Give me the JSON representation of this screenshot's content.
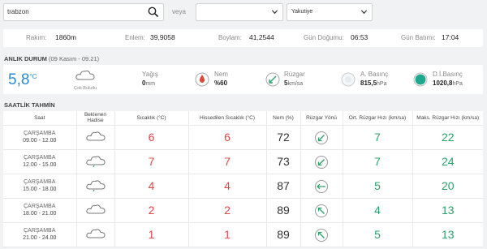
{
  "search": {
    "value": "trabzon",
    "placeholder": ""
  },
  "veya": "veya",
  "select1": {
    "value": ""
  },
  "select2": {
    "value": "Yakutiye"
  },
  "info": {
    "rakim_label": "Rakım:",
    "rakim_value": "1860",
    "rakim_unit": "m",
    "enlem_label": "Enlem:",
    "enlem_value": "39,9058",
    "boylam_label": "Boylam:",
    "boylam_value": "41,2544",
    "dogumu_label": "Gün Doğumu:",
    "dogumu_value": "06:53",
    "batimi_label": "Gün Batımı:",
    "batimi_value": "17:04"
  },
  "current_title": "ANLIK DURUM",
  "current_sub": "(09 Kasım - 09.21)",
  "current": {
    "temp": "5,8",
    "temp_unit": "°C",
    "condition": "Çok Bulutlu",
    "yagis_label": "Yağış",
    "yagis_value": "0",
    "yagis_unit": "mm",
    "nem_label": "Nem",
    "nem_value": "%60",
    "ruzgar_label": "Rüzgar",
    "ruzgar_value": "5",
    "ruzgar_unit": "km/sa",
    "basinc_label": "A. Basınç",
    "basinc_value": "815,5",
    "basinc_unit": "hPa",
    "dibasinc_label": "D.İ.Basınç",
    "dibasinc_value": "1020,8",
    "dibasinc_unit": "hPa"
  },
  "hourly_title": "SAATLİK TAHMİN",
  "table": {
    "headers": {
      "saat": "Saat",
      "hadise_1": "Beklenen",
      "hadise_2": "Hadise",
      "sicaklik": "Sıcaklık (°C)",
      "hissedilen": "Hissedilen Sıcaklık (°C)",
      "nem": "Nem (%)",
      "yon": "Rüzgar Yönü",
      "ort": "Ort. Rüzgar Hızı (km/sa)",
      "maks": "Maks. Rüzgar Hızı (km/sa)"
    },
    "rows": [
      {
        "day": "ÇARŞAMBA",
        "time": "09.00 - 12.00",
        "icon": "cloud-icon",
        "temp": "6",
        "feels": "6",
        "hum": "72",
        "dir_deg": 225,
        "avg": "7",
        "max": "22"
      },
      {
        "day": "ÇARŞAMBA",
        "time": "12.00 - 15.00",
        "icon": "cloud-rain-icon",
        "temp": "7",
        "feels": "7",
        "hum": "73",
        "dir_deg": 225,
        "avg": "7",
        "max": "24"
      },
      {
        "day": "ÇARŞAMBA",
        "time": "15.00 - 18.00",
        "icon": "cloud-rain-icon",
        "temp": "4",
        "feels": "4",
        "hum": "87",
        "dir_deg": 270,
        "avg": "5",
        "max": "20"
      },
      {
        "day": "ÇARŞAMBA",
        "time": "18.00 - 21.00",
        "icon": "cloud-icon",
        "temp": "2",
        "feels": "2",
        "hum": "89",
        "dir_deg": 315,
        "avg": "4",
        "max": "13"
      },
      {
        "day": "ÇARŞAMBA",
        "time": "21.00 - 24.00",
        "icon": "cloud-icon",
        "temp": "1",
        "feels": "1",
        "hum": "89",
        "dir_deg": 315,
        "avg": "5",
        "max": "13"
      }
    ]
  },
  "colors": {
    "accent_blue": "#2b8ad8",
    "temp_red": "#e04848",
    "wind_green": "#2aa26a",
    "dibasinc_teal": "#1fa88f"
  }
}
